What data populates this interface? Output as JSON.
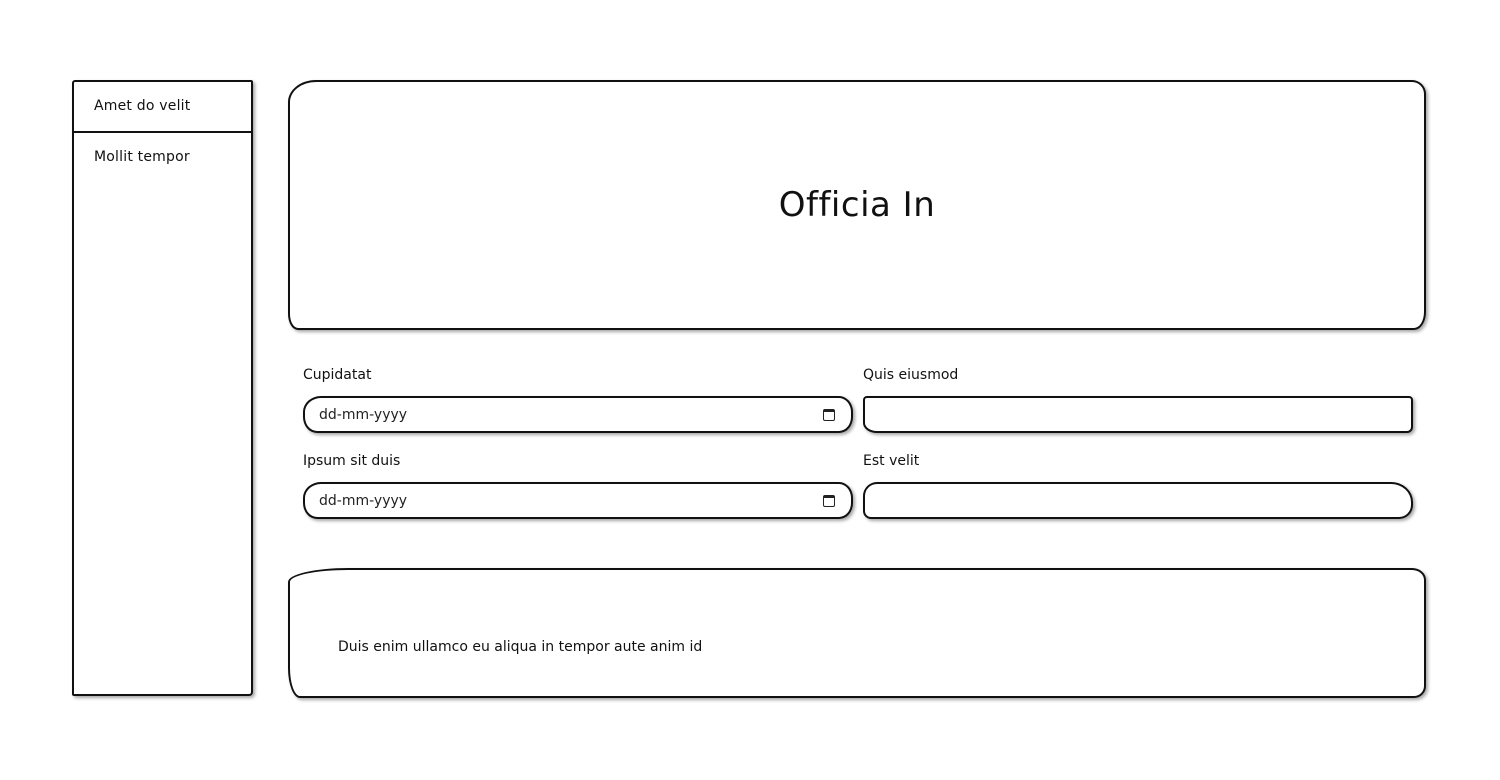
{
  "sidebar": {
    "items": [
      {
        "label": "Amet do velit"
      },
      {
        "label": "Mollit tempor"
      }
    ]
  },
  "hero": {
    "title": "Officia In"
  },
  "form": {
    "fields": [
      {
        "label": "Cupidatat",
        "type": "date",
        "placeholder": "dd-mm-yyyy",
        "icon": "calendar-icon"
      },
      {
        "label": "Quis eiusmod",
        "type": "text",
        "value": ""
      },
      {
        "label": "Ipsum sit duis",
        "type": "date",
        "placeholder": "dd-mm-yyyy",
        "icon": "calendar-icon"
      },
      {
        "label": "Est velit",
        "type": "text",
        "value": ""
      }
    ]
  },
  "footer": {
    "text": "Duis enim ullamco eu aliqua in tempor aute anim id"
  }
}
